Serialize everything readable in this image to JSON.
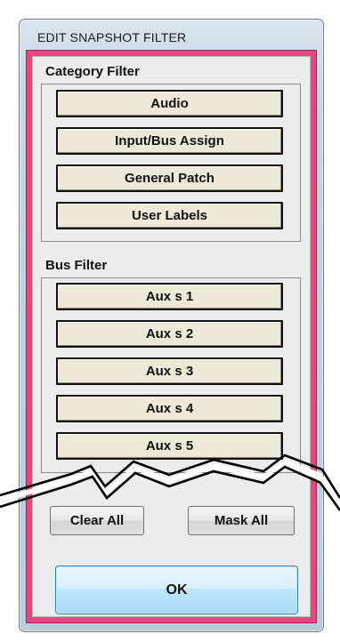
{
  "dialog": {
    "title": "EDIT SNAPSHOT FILTER"
  },
  "category_filter": {
    "label": "Category Filter",
    "items": [
      "Audio",
      "Input/Bus Assign",
      "General Patch",
      "User Labels"
    ]
  },
  "bus_filter": {
    "label": "Bus Filter",
    "items": [
      "Aux s  1",
      "Aux s  2",
      "Aux s  3",
      "Aux s  4",
      "Aux s  5"
    ]
  },
  "actions": {
    "clear_all": "Clear All",
    "mask_all": "Mask All",
    "ok": "OK"
  },
  "colors": {
    "frame": "#e8467f",
    "ok_button": "#bee6fd",
    "filter_button": "#ece9d8"
  }
}
